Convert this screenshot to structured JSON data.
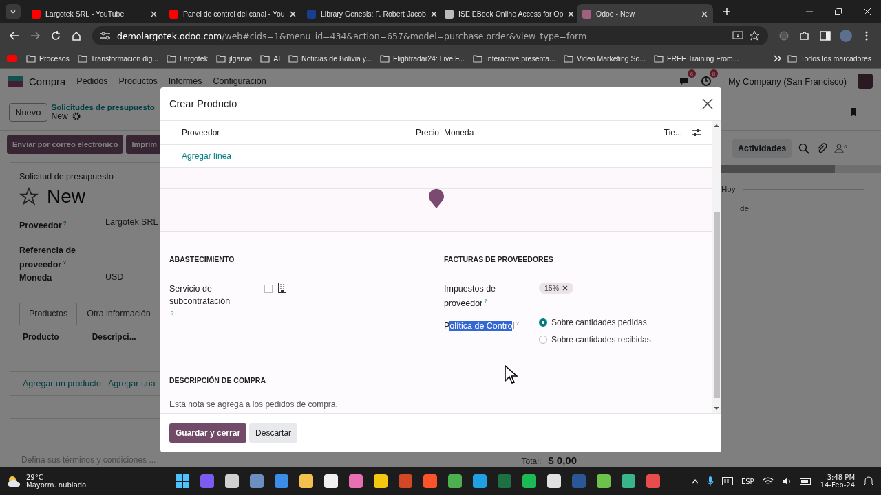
{
  "browser": {
    "tabs": [
      {
        "title": "Largotek SRL - YouTube",
        "kind": "video",
        "selected": false
      },
      {
        "title": "Panel de control del canal - You",
        "kind": "video",
        "selected": false
      },
      {
        "title": "Library Genesis: F. Robert Jacob",
        "kind": "book",
        "selected": false
      },
      {
        "title": "ISE EBook Online Access for Op",
        "kind": "globe",
        "selected": false
      },
      {
        "title": "Odoo - New",
        "kind": "odoo",
        "selected": true
      }
    ],
    "url_host": "demolargotek.odoo.com",
    "url_path": "/web#cids=1&menu_id=434&action=657&model=purchase.order&view_type=form",
    "bookmarks": [
      {
        "label": "Procesos"
      },
      {
        "label": "Transformacion dig..."
      },
      {
        "label": "Largotek"
      },
      {
        "label": "jlgarvia"
      },
      {
        "label": "AI"
      },
      {
        "label": "Noticias de Bolivia y..."
      },
      {
        "label": "Flightradar24: Live F..."
      },
      {
        "label": "Interactive presenta..."
      },
      {
        "label": "Video Marketing So..."
      },
      {
        "label": "FREE Training From..."
      }
    ],
    "all_bookmarks": "Todos los marcadores"
  },
  "app": {
    "app_name": "Compra",
    "menu": [
      "Pedidos",
      "Productos",
      "Informes",
      "Configuración"
    ],
    "chat_count": "6",
    "activity_count": "8",
    "company": "My Company (San Francisco)",
    "new_button": "Nuevo",
    "breadcrumb": "Solicitudes de presupuesto",
    "record": "New",
    "action_buttons": [
      "Enviar por correo electrónico",
      "Imprim"
    ],
    "form": {
      "subtitle": "Solicitud de presupuesto",
      "title": "New",
      "starred": false,
      "fields": [
        {
          "label": "Proveedor",
          "help": "?",
          "value": "Largotek SRL"
        },
        {
          "label": "Referencia de proveedor",
          "help": "?"
        },
        {
          "label": "Moneda",
          "value": "USD"
        }
      ],
      "tabs": [
        {
          "label": "Productos",
          "selected": true
        },
        {
          "label": "Otra información",
          "selected": false
        }
      ],
      "columns": [
        "Producto",
        "Descripci..."
      ],
      "links": [
        "Agregar un producto",
        "Agregar una"
      ],
      "terms_placeholder": "Defina sus términos y condiciones ...",
      "total_label": "Total:",
      "total_value": "$ 0,00"
    },
    "chatter": {
      "activities_button": "Actividades",
      "followers_count": "0",
      "today_label": "Hoy",
      "note": "de"
    }
  },
  "modal": {
    "title": "Crear Producto",
    "table": {
      "columns": [
        "Proveedor",
        "Precio",
        "Moneda",
        "Tie..."
      ],
      "add_line": "Agregar línea"
    },
    "procurement": {
      "title": "ABASTECIMIENTO",
      "subcontract_label": "Servicio de subcontratación",
      "help": "?",
      "checked": false
    },
    "invoices": {
      "title": "FACTURAS DE PROVEEDORES",
      "taxes_label": "Impuestos de proveedor",
      "taxes_help": "?",
      "tags": [
        "15%"
      ],
      "policy_label": [
        {
          "text": "P",
          "highlighted": false
        },
        {
          "text": "olítica de Contro",
          "highlighted": true
        },
        {
          "text": "l",
          "highlighted": false
        }
      ],
      "policy_help": "?",
      "options": [
        {
          "label": "Sobre cantidades pedidas",
          "selected": true
        },
        {
          "label": "Sobre cantidades recibidas",
          "selected": false
        }
      ]
    },
    "description": {
      "title": "DESCRIPCIÓN DE COMPRA",
      "placeholder": "Esta nota se agrega a los pedidos de compra."
    },
    "save_button": "Guardar y cerrar",
    "discard_button": "Descartar"
  },
  "taskbar": {
    "temperature": "29°C",
    "weather": "Mayorm. nublado",
    "language": "ESP",
    "time": "3:48 PM",
    "date": "14-Feb-24"
  }
}
